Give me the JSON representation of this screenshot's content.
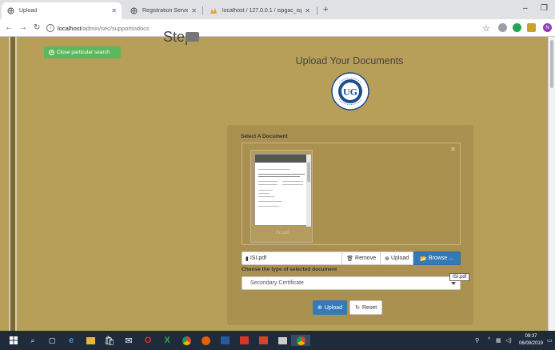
{
  "browser": {
    "tabs": [
      {
        "title": "Upload",
        "active": true
      },
      {
        "title": "Registration Services",
        "active": false
      },
      {
        "title": "localhost / 127.0.0.1 / ispgac_isp",
        "active": false
      }
    ],
    "address_host": "localhost",
    "address_path": "/admin/sec/supportindocs"
  },
  "page": {
    "step_label": "Step",
    "close_search_label": "Close particular search",
    "heading": "Upload Your Documents",
    "logo_text": "UG",
    "logo_ring_text": "UNIVERSITY OF GHANA"
  },
  "upload": {
    "select_label": "Select A Document",
    "thumb_name": "ISI.pdf",
    "file_name": "ISI.pdf",
    "remove_label": "Remove",
    "upload_label": "Upload",
    "browse_label": "Browse ...",
    "choose_label": "Choose the type of selected document",
    "doc_type": "Secondary Certificate",
    "tooltip": "ISI.pdf",
    "submit_label": "Upload",
    "reset_label": "Reset"
  },
  "taskbar": {
    "time": "09:37",
    "date": "06/09/2019"
  },
  "colors": {
    "page_bg": "#b79f5a",
    "green": "#5cb85c",
    "primary": "#337ab7"
  }
}
